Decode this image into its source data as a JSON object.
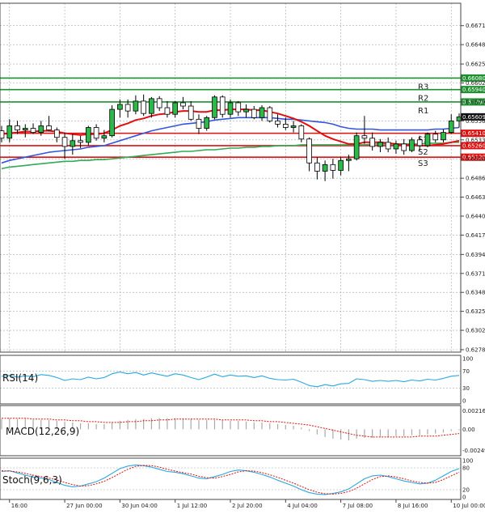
{
  "colors": {
    "up": "#1a8a2a",
    "down": "#d62020",
    "ema_fast": "#e01010",
    "ema_mid": "#3355dd",
    "ema_slow": "#33aa55",
    "resistance": "#1e8f2e",
    "support": "#e01010",
    "current": "#111111",
    "indicator": "#2aa8e0",
    "signal": "#e01010",
    "grid": "#9ea8b0",
    "axis_text": "#222222"
  },
  "chart_data": [
    {
      "type": "candlestick",
      "title": "",
      "xlabel": "",
      "ylabel": "",
      "ylim": [
        0.62785,
        0.6683
      ],
      "price_ticks": [
        "0.66715",
        "0.66485",
        "0.66250",
        "0.66020",
        "0.65790",
        "0.65560",
        "0.65330",
        "0.65100",
        "0.64865",
        "0.64635",
        "0.64405",
        "0.64175",
        "0.63940",
        "0.63710",
        "0.63480",
        "0.63250",
        "0.63020",
        "0.62785"
      ],
      "time_labels": [
        {
          "i": 1,
          "label": "16:00"
        },
        {
          "i": 8,
          "label": "27 Jun 00:00"
        },
        {
          "i": 15,
          "label": "30 Jun 04:00"
        },
        {
          "i": 22,
          "label": "1 Jul 12:00"
        },
        {
          "i": 29,
          "label": "2 Jul 20:00"
        },
        {
          "i": 36,
          "label": "4 Jul 04:00"
        },
        {
          "i": 43,
          "label": "7 Jul 08:00"
        },
        {
          "i": 50,
          "label": "8 Jul 16:00"
        },
        {
          "i": 57,
          "label": "10 Jul 00:00"
        }
      ],
      "levels": [
        {
          "name": "R3",
          "value": 0.6608,
          "label": "0.66080",
          "kind": "resistance"
        },
        {
          "name": "R2",
          "value": 0.6594,
          "label": "0.65940",
          "kind": "resistance"
        },
        {
          "name": "R1",
          "value": 0.6579,
          "label": "0.65790",
          "kind": "resistance"
        },
        {
          "name": "S1",
          "value": 0.6541,
          "label": "0.65410",
          "kind": "support"
        },
        {
          "name": "S2",
          "value": 0.6526,
          "label": "0.65260",
          "kind": "support"
        },
        {
          "name": "S3",
          "value": 0.6512,
          "label": "0.65120",
          "kind": "support"
        }
      ],
      "current_price": {
        "value": 0.65609,
        "label": "0.65609"
      },
      "candles": [
        {
          "o": 0.6544,
          "h": 0.655,
          "l": 0.653,
          "c": 0.6535
        },
        {
          "o": 0.6535,
          "h": 0.6558,
          "l": 0.653,
          "c": 0.655
        },
        {
          "o": 0.655,
          "h": 0.6556,
          "l": 0.654,
          "c": 0.6545
        },
        {
          "o": 0.6545,
          "h": 0.6552,
          "l": 0.6536,
          "c": 0.6547
        },
        {
          "o": 0.6547,
          "h": 0.6553,
          "l": 0.654,
          "c": 0.6542
        },
        {
          "o": 0.6542,
          "h": 0.6556,
          "l": 0.6538,
          "c": 0.655
        },
        {
          "o": 0.655,
          "h": 0.6562,
          "l": 0.6544,
          "c": 0.6545
        },
        {
          "o": 0.6545,
          "h": 0.6548,
          "l": 0.653,
          "c": 0.6536
        },
        {
          "o": 0.6536,
          "h": 0.6542,
          "l": 0.651,
          "c": 0.6525
        },
        {
          "o": 0.6525,
          "h": 0.654,
          "l": 0.6515,
          "c": 0.6532
        },
        {
          "o": 0.6532,
          "h": 0.6538,
          "l": 0.6523,
          "c": 0.653
        },
        {
          "o": 0.653,
          "h": 0.655,
          "l": 0.6526,
          "c": 0.6548
        },
        {
          "o": 0.6548,
          "h": 0.6552,
          "l": 0.6532,
          "c": 0.6535
        },
        {
          "o": 0.6535,
          "h": 0.6545,
          "l": 0.653,
          "c": 0.6538
        },
        {
          "o": 0.6538,
          "h": 0.6575,
          "l": 0.6536,
          "c": 0.657
        },
        {
          "o": 0.657,
          "h": 0.6582,
          "l": 0.656,
          "c": 0.6576
        },
        {
          "o": 0.6576,
          "h": 0.6582,
          "l": 0.656,
          "c": 0.6568
        },
        {
          "o": 0.6568,
          "h": 0.6587,
          "l": 0.6564,
          "c": 0.658
        },
        {
          "o": 0.658,
          "h": 0.6588,
          "l": 0.6562,
          "c": 0.6565
        },
        {
          "o": 0.6565,
          "h": 0.6585,
          "l": 0.656,
          "c": 0.6583
        },
        {
          "o": 0.6583,
          "h": 0.6586,
          "l": 0.6568,
          "c": 0.6572
        },
        {
          "o": 0.6572,
          "h": 0.658,
          "l": 0.656,
          "c": 0.6564
        },
        {
          "o": 0.6564,
          "h": 0.658,
          "l": 0.656,
          "c": 0.6578
        },
        {
          "o": 0.6578,
          "h": 0.6585,
          "l": 0.657,
          "c": 0.6574
        },
        {
          "o": 0.6574,
          "h": 0.658,
          "l": 0.6556,
          "c": 0.6558
        },
        {
          "o": 0.6558,
          "h": 0.6564,
          "l": 0.654,
          "c": 0.6547
        },
        {
          "o": 0.6547,
          "h": 0.6562,
          "l": 0.6544,
          "c": 0.656
        },
        {
          "o": 0.656,
          "h": 0.6587,
          "l": 0.6558,
          "c": 0.6585
        },
        {
          "o": 0.6585,
          "h": 0.6587,
          "l": 0.656,
          "c": 0.6564
        },
        {
          "o": 0.6564,
          "h": 0.6582,
          "l": 0.656,
          "c": 0.6578
        },
        {
          "o": 0.6578,
          "h": 0.658,
          "l": 0.6562,
          "c": 0.6567
        },
        {
          "o": 0.6567,
          "h": 0.6576,
          "l": 0.656,
          "c": 0.657
        },
        {
          "o": 0.657,
          "h": 0.6574,
          "l": 0.6558,
          "c": 0.656
        },
        {
          "o": 0.656,
          "h": 0.6575,
          "l": 0.6556,
          "c": 0.6572
        },
        {
          "o": 0.6572,
          "h": 0.6574,
          "l": 0.6554,
          "c": 0.6556
        },
        {
          "o": 0.6556,
          "h": 0.6564,
          "l": 0.6548,
          "c": 0.6552
        },
        {
          "o": 0.6552,
          "h": 0.656,
          "l": 0.6545,
          "c": 0.6548
        },
        {
          "o": 0.6548,
          "h": 0.6556,
          "l": 0.6542,
          "c": 0.655
        },
        {
          "o": 0.655,
          "h": 0.6552,
          "l": 0.653,
          "c": 0.6534
        },
        {
          "o": 0.6534,
          "h": 0.6536,
          "l": 0.6495,
          "c": 0.6505
        },
        {
          "o": 0.6505,
          "h": 0.6512,
          "l": 0.6485,
          "c": 0.6495
        },
        {
          "o": 0.6495,
          "h": 0.6508,
          "l": 0.6483,
          "c": 0.6503
        },
        {
          "o": 0.6503,
          "h": 0.651,
          "l": 0.6486,
          "c": 0.6496
        },
        {
          "o": 0.6496,
          "h": 0.6512,
          "l": 0.649,
          "c": 0.6508
        },
        {
          "o": 0.6508,
          "h": 0.6515,
          "l": 0.6495,
          "c": 0.651
        },
        {
          "o": 0.651,
          "h": 0.6542,
          "l": 0.6508,
          "c": 0.6538
        },
        {
          "o": 0.6538,
          "h": 0.6562,
          "l": 0.6528,
          "c": 0.6535
        },
        {
          "o": 0.6535,
          "h": 0.6542,
          "l": 0.652,
          "c": 0.6525
        },
        {
          "o": 0.6525,
          "h": 0.6534,
          "l": 0.6518,
          "c": 0.653
        },
        {
          "o": 0.653,
          "h": 0.6536,
          "l": 0.6518,
          "c": 0.6522
        },
        {
          "o": 0.6522,
          "h": 0.6532,
          "l": 0.6516,
          "c": 0.6528
        },
        {
          "o": 0.6528,
          "h": 0.6534,
          "l": 0.6515,
          "c": 0.652
        },
        {
          "o": 0.652,
          "h": 0.6536,
          "l": 0.6518,
          "c": 0.6533
        },
        {
          "o": 0.6533,
          "h": 0.6538,
          "l": 0.652,
          "c": 0.6526
        },
        {
          "o": 0.6526,
          "h": 0.6542,
          "l": 0.6524,
          "c": 0.654
        },
        {
          "o": 0.654,
          "h": 0.6544,
          "l": 0.653,
          "c": 0.6533
        },
        {
          "o": 0.6533,
          "h": 0.6546,
          "l": 0.653,
          "c": 0.6542
        },
        {
          "o": 0.6542,
          "h": 0.6564,
          "l": 0.654,
          "c": 0.6556
        },
        {
          "o": 0.6556,
          "h": 0.6565,
          "l": 0.6548,
          "c": 0.65609
        }
      ],
      "ema_fast": [
        0.654,
        0.6541,
        0.6542,
        0.6543,
        0.6543,
        0.6544,
        0.6544,
        0.6543,
        0.6541,
        0.654,
        0.6539,
        0.654,
        0.654,
        0.6541,
        0.6545,
        0.655,
        0.6553,
        0.6557,
        0.6559,
        0.6562,
        0.6564,
        0.6565,
        0.6567,
        0.6568,
        0.6568,
        0.6567,
        0.6567,
        0.6569,
        0.6569,
        0.657,
        0.657,
        0.657,
        0.6569,
        0.6569,
        0.6567,
        0.6565,
        0.6562,
        0.6559,
        0.6555,
        0.655,
        0.6544,
        0.6538,
        0.6534,
        0.6531,
        0.6528,
        0.6528,
        0.653,
        0.653,
        0.653,
        0.6529,
        0.6528,
        0.6527,
        0.6527,
        0.6526,
        0.6526,
        0.6527,
        0.6528,
        0.653,
        0.6532
      ],
      "ema_mid": [
        0.6505,
        0.6508,
        0.651,
        0.6512,
        0.6514,
        0.6516,
        0.6518,
        0.6519,
        0.652,
        0.6521,
        0.6522,
        0.6524,
        0.6525,
        0.6526,
        0.6529,
        0.6532,
        0.6535,
        0.6538,
        0.6541,
        0.6544,
        0.6546,
        0.6548,
        0.655,
        0.6552,
        0.6553,
        0.6554,
        0.6555,
        0.6557,
        0.6558,
        0.6559,
        0.656,
        0.656,
        0.656,
        0.656,
        0.656,
        0.6559,
        0.6558,
        0.6558,
        0.6557,
        0.6556,
        0.6555,
        0.6554,
        0.6552,
        0.6549,
        0.6547,
        0.6546,
        0.6546,
        0.6546,
        0.6545,
        0.6545,
        0.6545,
        0.6545,
        0.6545,
        0.6545,
        0.6545,
        0.6546,
        0.6546,
        0.6547,
        0.6548
      ],
      "ema_slow": [
        0.6498,
        0.65,
        0.6501,
        0.6502,
        0.6503,
        0.6504,
        0.6505,
        0.6506,
        0.6507,
        0.6507,
        0.6508,
        0.6508,
        0.6509,
        0.6509,
        0.651,
        0.6511,
        0.6512,
        0.6513,
        0.6514,
        0.6515,
        0.6516,
        0.6517,
        0.6518,
        0.6519,
        0.6519,
        0.652,
        0.6521,
        0.6521,
        0.6522,
        0.6523,
        0.6523,
        0.6524,
        0.6524,
        0.6525,
        0.6525,
        0.6526,
        0.6526,
        0.6526,
        0.6527,
        0.6527,
        0.6527,
        0.6527,
        0.6527,
        0.6527,
        0.6527,
        0.6527,
        0.6527,
        0.6528,
        0.6528,
        0.6528,
        0.6528,
        0.6528,
        0.6528,
        0.6528,
        0.6529,
        0.6529,
        0.6529,
        0.653,
        0.653
      ]
    },
    {
      "type": "line",
      "name": "RSI(14)",
      "label": "RSI(14)",
      "ylim": [
        0,
        100
      ],
      "ticks": [
        "100",
        "70",
        "30",
        "0"
      ],
      "levels": [
        70,
        30
      ],
      "values": [
        58,
        60,
        56,
        59,
        57,
        62,
        60,
        55,
        48,
        52,
        50,
        56,
        52,
        55,
        64,
        68,
        64,
        67,
        61,
        66,
        62,
        58,
        64,
        61,
        55,
        50,
        56,
        63,
        57,
        61,
        58,
        59,
        55,
        59,
        53,
        50,
        49,
        51,
        44,
        36,
        33,
        38,
        35,
        40,
        41,
        52,
        50,
        46,
        48,
        46,
        48,
        45,
        49,
        47,
        51,
        49,
        53,
        58,
        60
      ]
    },
    {
      "type": "bar",
      "name": "MACD(12,26,9)",
      "label": "MACD(12,26,9)",
      "ylim": [
        -0.00262,
        0.00231
      ],
      "ticks": [
        "0.002164",
        "0.00",
        "-0.002497"
      ],
      "histogram": [
        0.0012,
        0.0013,
        0.0012,
        0.0012,
        0.0011,
        0.0011,
        0.0011,
        0.001,
        0.0009,
        0.0008,
        0.0007,
        0.0007,
        0.0006,
        0.0006,
        0.0008,
        0.001,
        0.0011,
        0.0012,
        0.0012,
        0.0013,
        0.0013,
        0.0013,
        0.0013,
        0.0013,
        0.0012,
        0.0011,
        0.0011,
        0.0011,
        0.0011,
        0.001,
        0.001,
        0.0009,
        0.0008,
        0.0008,
        0.0007,
        0.0006,
        0.0005,
        0.0004,
        0.0002,
        -0.0002,
        -0.0006,
        -0.0009,
        -0.0011,
        -0.0012,
        -0.0013,
        -0.0011,
        -0.001,
        -0.001,
        -0.0009,
        -0.0009,
        -0.0008,
        -0.0008,
        -0.0007,
        -0.0007,
        -0.0006,
        -0.0005,
        -0.0004,
        -0.0002,
        -0.0001
      ],
      "signal": [
        0.0013,
        0.0013,
        0.0013,
        0.0013,
        0.0012,
        0.0012,
        0.0012,
        0.0011,
        0.0011,
        0.001,
        0.001,
        0.0009,
        0.0009,
        0.0008,
        0.0008,
        0.0008,
        0.0009,
        0.0009,
        0.001,
        0.001,
        0.0011,
        0.0011,
        0.0012,
        0.0012,
        0.0012,
        0.0012,
        0.0012,
        0.0012,
        0.0011,
        0.0011,
        0.0011,
        0.0011,
        0.001,
        0.001,
        0.0009,
        0.0009,
        0.0008,
        0.0007,
        0.0006,
        0.0005,
        0.0003,
        0.0001,
        -0.0001,
        -0.0003,
        -0.0005,
        -0.0007,
        -0.0008,
        -0.0009,
        -0.0009,
        -0.0009,
        -0.0009,
        -0.0009,
        -0.0009,
        -0.0008,
        -0.0008,
        -0.0008,
        -0.0007,
        -0.0006,
        -0.0005
      ]
    },
    {
      "type": "line",
      "name": "Stoch(9,6,3)",
      "label": "Stoch(9,6,3)",
      "ylim": [
        0,
        100
      ],
      "ticks": [
        "100",
        "80",
        "20",
        "0"
      ],
      "levels": [
        80,
        20
      ],
      "main": [
        70,
        72,
        66,
        60,
        55,
        52,
        48,
        40,
        32,
        28,
        30,
        36,
        42,
        52,
        65,
        78,
        85,
        88,
        86,
        82,
        76,
        70,
        68,
        64,
        58,
        52,
        50,
        56,
        62,
        70,
        74,
        72,
        68,
        62,
        55,
        46,
        38,
        30,
        20,
        12,
        8,
        7,
        10,
        14,
        22,
        36,
        50,
        58,
        60,
        56,
        50,
        44,
        40,
        36,
        38,
        46,
        58,
        70,
        78
      ],
      "signal": [
        72,
        71,
        69,
        65,
        60,
        56,
        52,
        47,
        40,
        34,
        30,
        31,
        36,
        43,
        53,
        65,
        76,
        84,
        87,
        86,
        82,
        76,
        71,
        67,
        63,
        57,
        53,
        52,
        56,
        62,
        69,
        72,
        71,
        67,
        61,
        54,
        46,
        38,
        29,
        20,
        13,
        9,
        8,
        10,
        15,
        24,
        36,
        48,
        56,
        58,
        55,
        50,
        44,
        40,
        38,
        40,
        48,
        58,
        68
      ]
    }
  ]
}
